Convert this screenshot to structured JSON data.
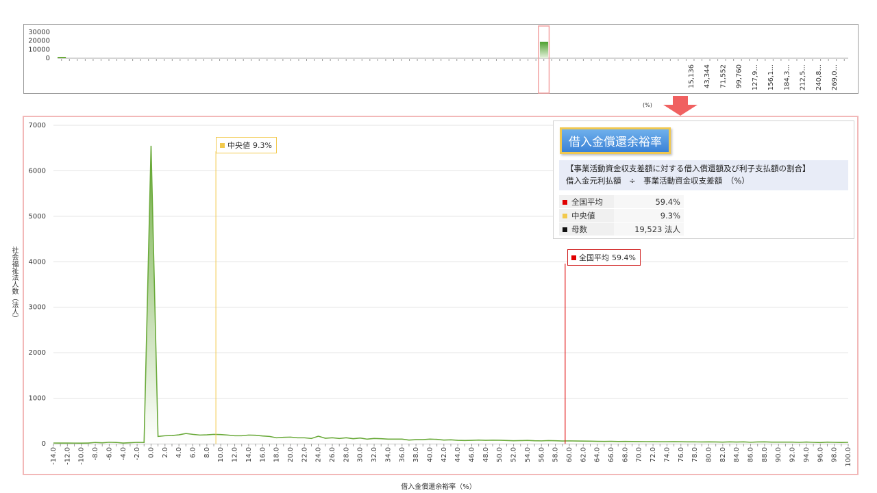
{
  "chart_data": [
    {
      "type": "area",
      "role": "overview",
      "y_ticks": [
        "30000",
        "20000",
        "10000",
        "0"
      ],
      "ylim": [
        0,
        30000
      ],
      "x_tick_labels": [
        "15,136",
        "43,344",
        "71,552",
        "99,760",
        "127,9...",
        "156,1...",
        "184,3...",
        "212,5...",
        "240,8...",
        "269,0..."
      ],
      "unit": "(%)",
      "highlight_bin": 61,
      "values": [
        1400,
        0,
        0,
        0,
        0,
        0,
        0,
        0,
        0,
        0,
        0,
        0,
        0,
        0,
        0,
        0,
        0,
        0,
        0,
        0,
        0,
        0,
        0,
        0,
        0,
        0,
        0,
        0,
        0,
        0,
        0,
        0,
        0,
        0,
        0,
        0,
        0,
        0,
        0,
        0,
        0,
        0,
        0,
        0,
        0,
        0,
        0,
        0,
        0,
        0,
        0,
        0,
        0,
        0,
        0,
        0,
        0,
        0,
        0,
        0,
        0,
        19000,
        0,
        0,
        0,
        0,
        0,
        0,
        0,
        0,
        0,
        0,
        0,
        0,
        0,
        0,
        0,
        0,
        0,
        0,
        0,
        0,
        0,
        0,
        0,
        0,
        0,
        0,
        0,
        0,
        0,
        0,
        0,
        0,
        0,
        0,
        0,
        0,
        0,
        0
      ]
    },
    {
      "type": "area",
      "role": "main",
      "x": [
        -14,
        -13,
        -12,
        -11,
        -10,
        -9,
        -8,
        -7,
        -6,
        -5,
        -4,
        -3,
        -2,
        -1,
        0,
        1,
        2,
        3,
        4,
        5,
        6,
        7,
        8,
        9,
        10,
        11,
        12,
        13,
        14,
        15,
        16,
        17,
        18,
        19,
        20,
        21,
        22,
        23,
        24,
        25,
        26,
        27,
        28,
        29,
        30,
        31,
        32,
        33,
        34,
        35,
        36,
        37,
        38,
        39,
        40,
        41,
        42,
        43,
        44,
        45,
        46,
        47,
        48,
        49,
        50,
        51,
        52,
        53,
        54,
        55,
        56,
        57,
        58,
        59,
        60,
        61,
        62,
        63,
        64,
        65,
        66,
        67,
        68,
        69,
        70,
        71,
        72,
        73,
        74,
        75,
        76,
        77,
        78,
        79,
        80,
        81,
        82,
        83,
        84,
        85,
        86,
        87,
        88,
        89,
        90,
        91,
        92,
        93,
        94,
        95,
        96,
        97,
        98,
        99,
        100
      ],
      "y": [
        15,
        14,
        14,
        13,
        12,
        14,
        28,
        20,
        32,
        28,
        14,
        22,
        30,
        28,
        6550,
        160,
        175,
        180,
        195,
        225,
        205,
        190,
        195,
        205,
        200,
        190,
        175,
        175,
        190,
        185,
        170,
        160,
        130,
        140,
        145,
        130,
        130,
        115,
        165,
        120,
        130,
        115,
        130,
        110,
        125,
        100,
        115,
        110,
        100,
        100,
        100,
        80,
        90,
        90,
        100,
        95,
        80,
        85,
        75,
        70,
        75,
        80,
        75,
        78,
        76,
        70,
        65,
        68,
        72,
        65,
        62,
        68,
        65,
        60,
        62,
        60,
        58,
        55,
        52,
        50,
        52,
        48,
        50,
        48,
        46,
        45,
        44,
        43,
        42,
        44,
        42,
        40,
        40,
        38,
        40,
        38,
        35,
        40,
        36,
        40,
        32,
        38,
        40,
        35,
        35,
        35,
        35,
        30,
        36,
        30,
        25,
        35,
        30,
        28,
        30
      ],
      "x_tick_labels": [
        "-14.0",
        "-12.0",
        "-10.0",
        "-8.0",
        "-6.0",
        "-4.0",
        "-2.0",
        "0.0",
        "2.0",
        "4.0",
        "6.0",
        "8.0",
        "10.0",
        "12.0",
        "14.0",
        "16.0",
        "18.0",
        "20.0",
        "22.0",
        "24.0",
        "26.0",
        "28.0",
        "30.0",
        "32.0",
        "34.0",
        "36.0",
        "38.0",
        "40.0",
        "42.0",
        "44.0",
        "46.0",
        "48.0",
        "50.0",
        "52.0",
        "54.0",
        "56.0",
        "58.0",
        "60.0",
        "62.0",
        "64.0",
        "66.0",
        "68.0",
        "70.0",
        "72.0",
        "74.0",
        "76.0",
        "78.0",
        "80.0",
        "82.0",
        "84.0",
        "86.0",
        "88.0",
        "90.0",
        "92.0",
        "94.0",
        "96.0",
        "98.0",
        "100.0"
      ],
      "y_ticks": [
        "7000",
        "6000",
        "5000",
        "4000",
        "3000",
        "2000",
        "1000",
        "0"
      ],
      "xlim": [
        -14,
        100
      ],
      "ylim": [
        0,
        7000
      ],
      "xlabel": "借入金償還余裕率（%）",
      "ylabel": "社会福祉法人数（法人）",
      "grid": true,
      "markers": [
        {
          "name": "中央値",
          "value_text": "9.3%",
          "x": 9.3,
          "color": "#f2c94c"
        },
        {
          "name": "全国平均",
          "value_text": "59.4%",
          "x": 59.4,
          "color": "#e00000"
        }
      ],
      "line_color": "#6aaa3a"
    }
  ],
  "info_panel": {
    "title": "借入金償還余裕率",
    "description_line1": "【事業活動資金収支差額に対する借入償還額及び利子支払額の割合】",
    "description_line2": "借入金元利払額　÷　事業活動資金収支差額　（%）",
    "rows": [
      {
        "label": "全国平均",
        "value": "59.4%",
        "color": "#e00000"
      },
      {
        "label": "中央値",
        "value": "9.3%",
        "color": "#f2c94c"
      },
      {
        "label": "母数",
        "value": "19,523  法人",
        "color": "#111111"
      }
    ]
  }
}
